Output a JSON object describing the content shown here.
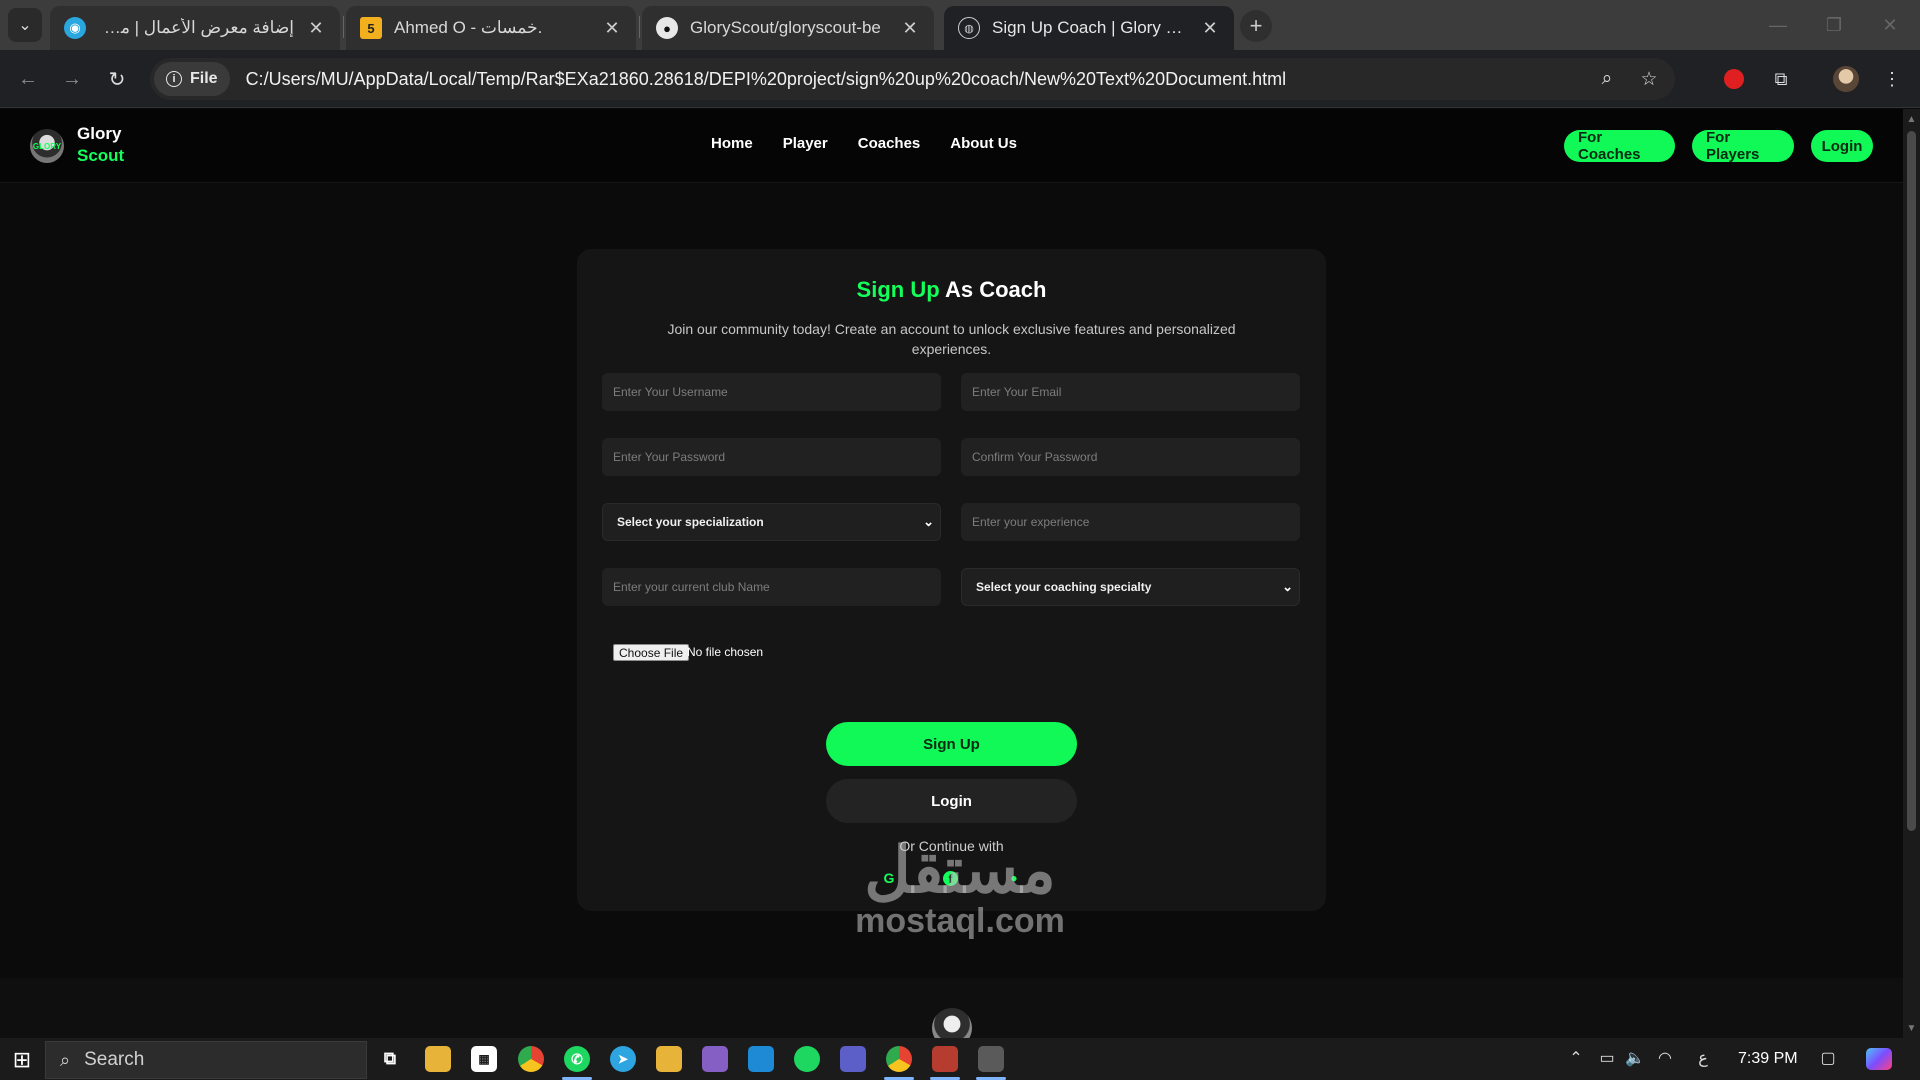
{
  "browser": {
    "tabs": [
      {
        "title": "إضافة معرض الأعمال | مستقل",
        "favicon": "mostaql-icon"
      },
      {
        "title": "Ahmed O - خمسات.",
        "favicon": "5"
      },
      {
        "title": "GloryScout/gloryscout-be",
        "favicon": "github-icon"
      },
      {
        "title": "Sign Up Coach | Glory Scout",
        "favicon": "globe-icon"
      }
    ],
    "chip_label": "File",
    "url": "C:/Users/MU/AppData/Local/Temp/Rar$EXa21860.28618/DEPI%20project/sign%20up%20coach/New%20Text%20Document.html"
  },
  "site": {
    "brand": {
      "line1": "Glory",
      "line2": "Scout",
      "logo_text": "GLORY"
    },
    "nav": [
      "Home",
      "Player",
      "Coaches",
      "About Us"
    ],
    "header_buttons": {
      "coaches": "For Coaches",
      "players": "For Players",
      "login": "Login"
    },
    "colors": {
      "accent": "#13ff5a",
      "background": "#0b0b0b",
      "card": "#151515"
    }
  },
  "form": {
    "title_highlight": "Sign Up",
    "title_rest": " As Coach",
    "subtitle": "Join our community today! Create an account to unlock exclusive features and personalized experiences.",
    "placeholders": {
      "username": "Enter Your Username",
      "email": "Enter Your Email",
      "password": "Enter Your Password",
      "confirm": "Confirm Your Password",
      "experience": "Enter your experience",
      "club": "Enter your current club Name"
    },
    "selects": {
      "specialization": "Select your specialization",
      "coaching_specialty": "Select your coaching specialty"
    },
    "file": {
      "button": "Choose File",
      "status": "No file chosen"
    },
    "signup_label": "Sign Up",
    "login_label": "Login",
    "continue_label": "Or Continue with",
    "social": {
      "google": "G",
      "facebook": "f",
      "apple": "●"
    }
  },
  "watermark": {
    "line1": "مستقل",
    "line2": "mostaql.com"
  },
  "taskbar": {
    "search_label": "Search",
    "lang": "ع",
    "time": "7:39 PM"
  }
}
